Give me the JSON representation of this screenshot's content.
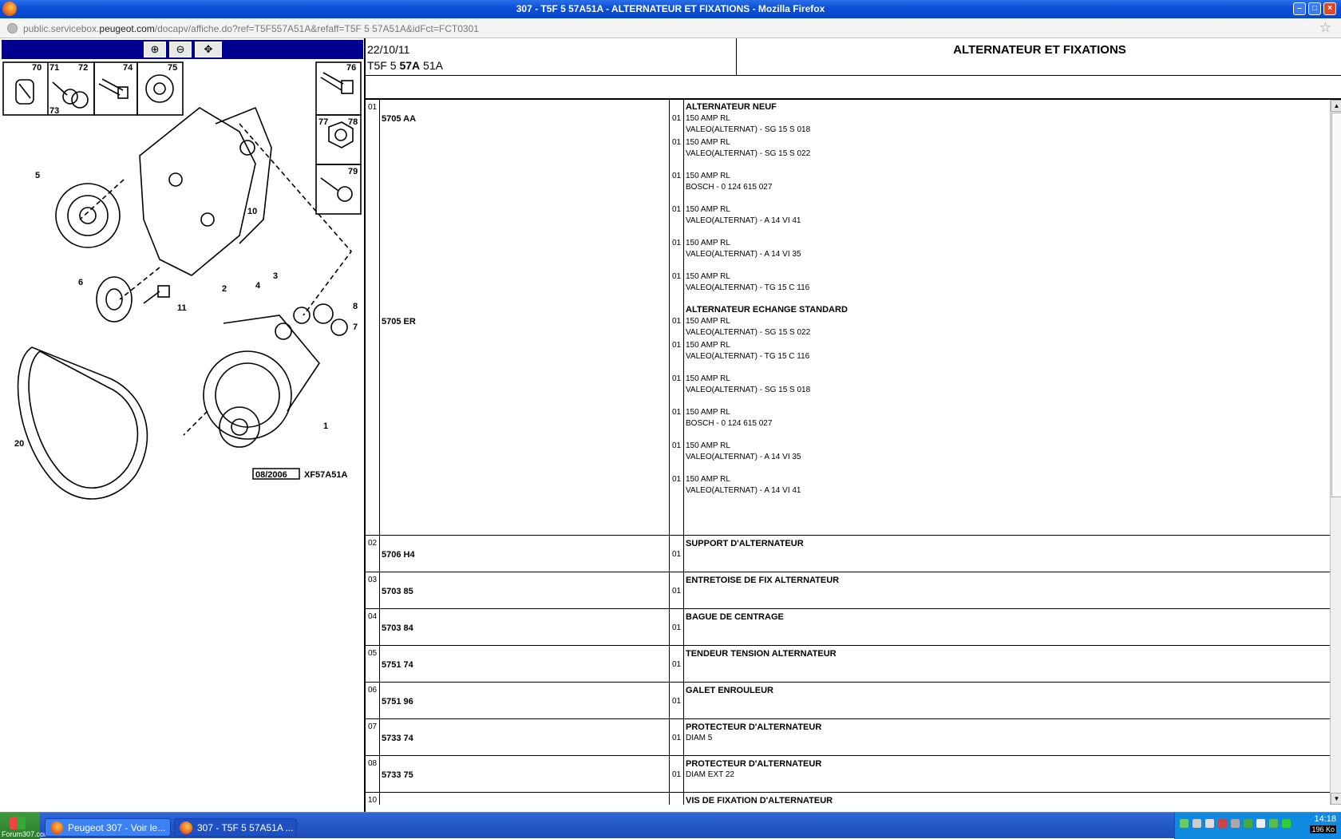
{
  "window": {
    "title": "307 - T5F 5 57A51A - ALTERNATEUR ET FIXATIONS - Mozilla Firefox"
  },
  "address": {
    "prefix": "public.servicebox.",
    "domain": "peugeot.com",
    "path": "/docapv/affiche.do?ref=T5F557A51A&refaff=T5F 5 57A51A&idFct=FCT0301"
  },
  "diagram": {
    "labels": [
      "70",
      "71",
      "72",
      "73",
      "74",
      "75",
      "76",
      "77",
      "78",
      "79",
      "5",
      "6",
      "1",
      "2",
      "3",
      "4",
      "7",
      "8",
      "10",
      "11",
      "20"
    ],
    "stamp_date": "08/2006",
    "stamp_ref": "XF57A51A"
  },
  "header": {
    "date": "22/10/11",
    "ref_prefix": "T5F 5 ",
    "ref_bold": "57A",
    "ref_suffix": " 51A",
    "title": "ALTERNATEUR ET FIXATIONS"
  },
  "rows": [
    {
      "num": "01",
      "ref_a": "5705 AA",
      "ref_b": "5705 ER"
    },
    {
      "num": "02",
      "ref": "5706 H4",
      "qty": "01",
      "desc": "SUPPORT D'ALTERNATEUR"
    },
    {
      "num": "03",
      "ref": "5703 85",
      "qty": "01",
      "desc": "ENTRETOISE DE FIX ALTERNATEUR"
    },
    {
      "num": "04",
      "ref": "5703 84",
      "qty": "01",
      "desc": "BAGUE DE CENTRAGE"
    },
    {
      "num": "05",
      "ref": "5751 74",
      "qty": "01",
      "desc": "TENDEUR TENSION ALTERNATEUR"
    },
    {
      "num": "06",
      "ref": "5751 96",
      "qty": "01",
      "desc": "GALET ENROULEUR"
    },
    {
      "num": "07",
      "ref": "5733 74",
      "qty": "01",
      "desc": "PROTECTEUR D'ALTERNATEUR",
      "sub": "DIAM 5"
    },
    {
      "num": "08",
      "ref": "5733 75",
      "qty": "01",
      "desc": "PROTECTEUR D'ALTERNATEUR",
      "sub": "DIAM EXT 22"
    },
    {
      "num": "10",
      "desc": "VIS DE FIXATION D'ALTERNATEUR"
    }
  ],
  "row1": {
    "group1": "ALTERNATEUR NEUF",
    "group2": "ALTERNATEUR ECHANGE STANDARD",
    "items": [
      {
        "qty": "01",
        "l1": "150 AMP RL",
        "l2": "VALEO(ALTERNAT) - SG 15 S 018"
      },
      {
        "qty": "01",
        "l1": "150 AMP RL",
        "l2": "VALEO(ALTERNAT) - SG 15 S 022"
      },
      {
        "qty": "01",
        "l1": "150 AMP RL",
        "l2": "BOSCH - 0 124 615 027"
      },
      {
        "qty": "01",
        "l1": "150 AMP RL",
        "l2": "VALEO(ALTERNAT) - A 14 VI 41"
      },
      {
        "qty": "01",
        "l1": "150 AMP RL",
        "l2": "VALEO(ALTERNAT) - A 14 VI 35"
      },
      {
        "qty": "01",
        "l1": "150 AMP RL",
        "l2": "VALEO(ALTERNAT) - TG 15 C 116"
      },
      {
        "qty": "01",
        "l1": "150 AMP RL",
        "l2": "VALEO(ALTERNAT) - SG 15 S 022"
      },
      {
        "qty": "01",
        "l1": "150 AMP RL",
        "l2": "VALEO(ALTERNAT) - TG 15 C 116"
      },
      {
        "qty": "01",
        "l1": "150 AMP RL",
        "l2": "VALEO(ALTERNAT) - SG 15 S 018"
      },
      {
        "qty": "01",
        "l1": "150 AMP RL",
        "l2": "BOSCH - 0 124 615 027"
      },
      {
        "qty": "01",
        "l1": "150 AMP RL",
        "l2": "VALEO(ALTERNAT) - A 14 VI 35"
      },
      {
        "qty": "01",
        "l1": "150 AMP RL",
        "l2": "VALEO(ALTERNAT) - A 14 VI 41"
      }
    ]
  },
  "taskbar": {
    "start_label": "Forum307.com",
    "tasks": [
      "Peugeot 307 - Voir le...",
      "307 - T5F 5 57A51A ..."
    ],
    "clock": "14:18",
    "clock_sub": "196 Ko"
  }
}
